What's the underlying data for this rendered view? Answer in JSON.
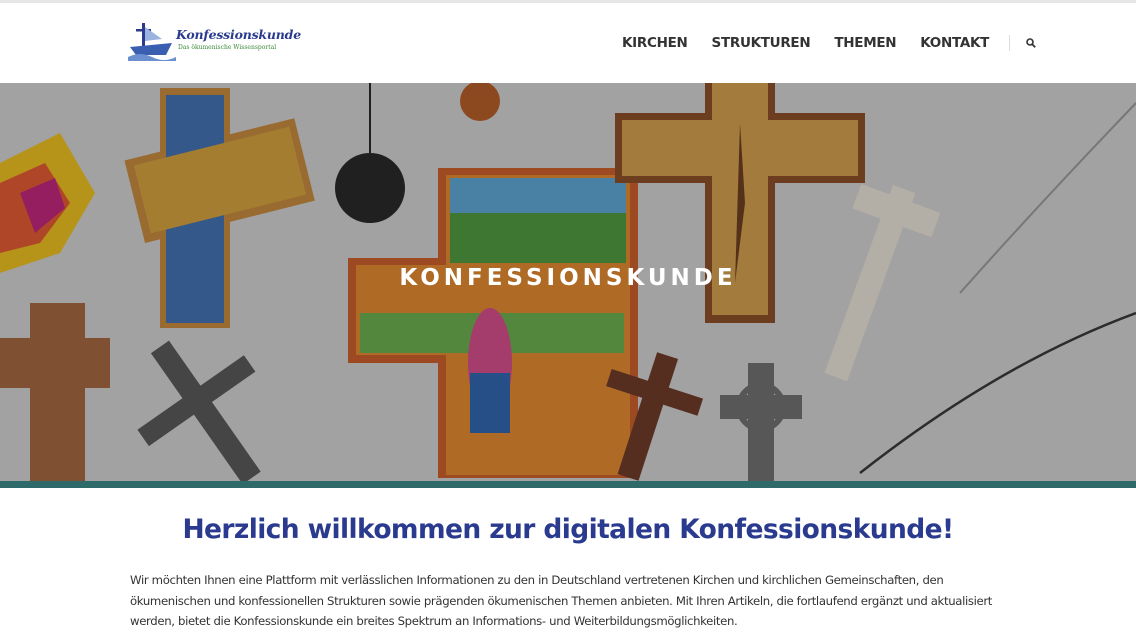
{
  "header": {
    "logo": {
      "title": "Konfessionskunde",
      "subtitle": "Das ökumenische Wissensportal"
    },
    "nav": [
      {
        "label": "KIRCHEN"
      },
      {
        "label": "STRUKTUREN"
      },
      {
        "label": "THEMEN"
      },
      {
        "label": "KONTAKT"
      }
    ],
    "search_icon": "search-icon"
  },
  "hero": {
    "title": "KONFESSIONSKUNDE",
    "image": "crosses-collection-photo"
  },
  "main": {
    "heading": "Herzlich willkommen zur digitalen Konfessionskunde!",
    "intro": "Wir möchten Ihnen eine Plattform mit verlässlichen Informationen zu den in Deutschland vertretenen Kirchen und kirchlichen Gemeinschaften, den ökumenischen und konfessionellen Strukturen sowie prägenden ökumenischen Themen anbieten. Mit Ihren Artikeln, die fortlaufend ergänzt und aktualisiert werden, bietet die Konfessionskunde ein breites Spektrum an Informations- und Weiterbildungsmöglichkeiten."
  },
  "colors": {
    "brand_blue": "#2a3a8f",
    "stripe_teal": "#2f6a6a",
    "logo_green": "#3a8a3a"
  }
}
